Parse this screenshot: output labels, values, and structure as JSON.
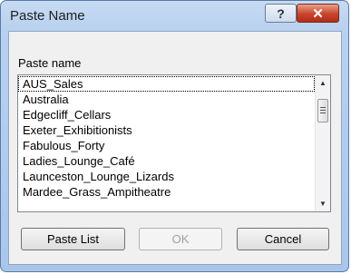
{
  "window": {
    "title": "Paste Name",
    "help_glyph": "?",
    "close_glyph": "✕"
  },
  "list": {
    "label": "Paste name",
    "items": [
      "AUS_Sales",
      "Australia",
      "Edgecliff_Cellars",
      "Exeter_Exhibitionists",
      "Fabulous_Forty",
      "Ladies_Lounge_Café",
      "Launceston_Lounge_Lizards",
      "Mardee_Grass_Ampitheatre"
    ],
    "selected_index": 0,
    "scroll_up_glyph": "▲",
    "scroll_down_glyph": "▼"
  },
  "buttons": {
    "paste_list": "Paste List",
    "ok": "OK",
    "cancel": "Cancel"
  }
}
